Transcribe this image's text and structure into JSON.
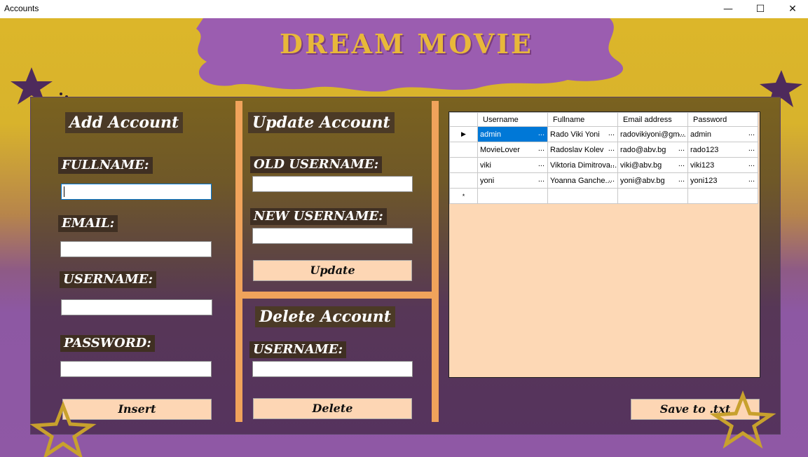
{
  "window": {
    "title": "Accounts",
    "minimize": "—",
    "maximize": "☐",
    "close": "✕"
  },
  "banner": {
    "title": "DREAM MOVIE"
  },
  "add_account": {
    "header": "Add Account",
    "fullname_label": "FULLNAME:",
    "email_label": "EMAIL:",
    "username_label": "USERNAME:",
    "password_label": "PASSWORD:",
    "fullname_value": "",
    "email_value": "",
    "username_value": "",
    "password_value": "",
    "insert_button": "Insert"
  },
  "update_account": {
    "header": "Update Account",
    "old_username_label": "OLD USERNAME:",
    "new_username_label": "NEW USERNAME:",
    "old_username_value": "",
    "new_username_value": "",
    "update_button": "Update"
  },
  "delete_account": {
    "header": "Delete Account",
    "username_label": "USERNAME:",
    "username_value": "",
    "delete_button": "Delete"
  },
  "grid": {
    "columns": [
      "Username",
      "Fullname",
      "Email address",
      "Password"
    ],
    "rows": [
      [
        "admin",
        "Rado Viki Yoni",
        "radovikiyoni@gm...",
        "admin"
      ],
      [
        "MovieLover",
        "Radoslav Kolev",
        "rado@abv.bg",
        "rado123"
      ],
      [
        "viki",
        "Viktoria Dimitrova...",
        "viki@abv.bg",
        "viki123"
      ],
      [
        "yoni",
        "Yoanna Ganche...",
        "yoni@abv.bg",
        "yoni123"
      ]
    ],
    "selected_row": 0,
    "current_row_marker": "▶",
    "new_row_marker": "*",
    "cell_ellipsis": "..."
  },
  "save_button": "Save to .txt",
  "colors": {
    "banner_purple": "#9b5db0",
    "title_gold": "#e8b83a",
    "button_peach": "#fdd6b4",
    "divider_orange": "#f0a35b",
    "selection_blue": "#0078d7"
  }
}
